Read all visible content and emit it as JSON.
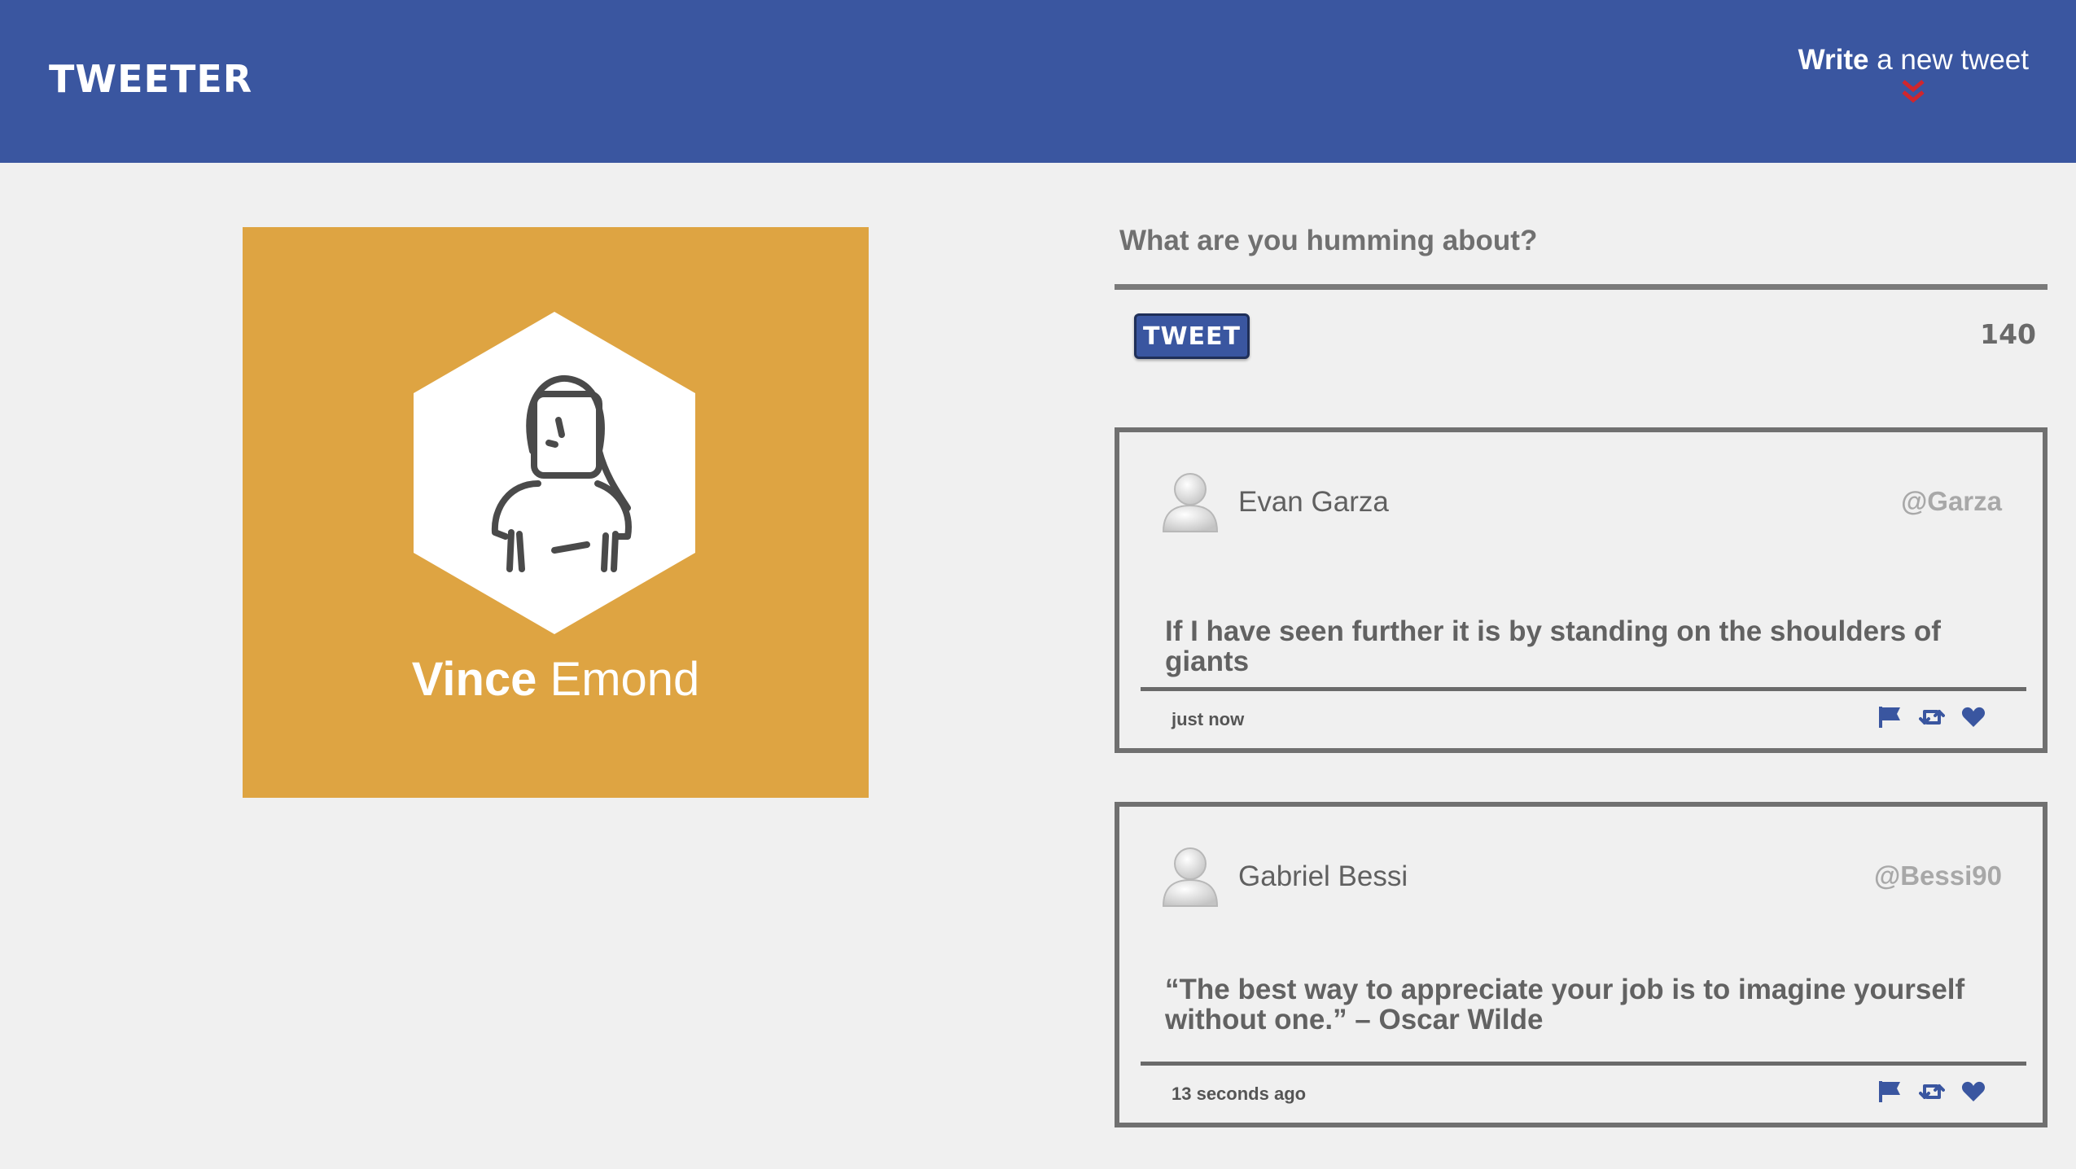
{
  "header": {
    "brand": "TWEETER",
    "compose_bold": "Write",
    "compose_rest": " a new tweet"
  },
  "profile": {
    "first_name": "Vince",
    "last_name": " Emond"
  },
  "compose": {
    "placeholder": "What are you humming about?",
    "button_label": "TWEET",
    "counter": "140"
  },
  "tweets": [
    {
      "name": "Evan Garza",
      "handle": "@Garza",
      "body": "If I have seen further it is by standing on the shoulders of giants",
      "time": "just now"
    },
    {
      "name": "Gabriel Bessi",
      "handle": "@Bessi90",
      "body": "“The best way to appreciate your job is to imagine yourself without one.” – Oscar Wilde",
      "time": "13 seconds ago"
    }
  ],
  "colors": {
    "nav": "#3a56a0",
    "profile_card": "#dea442",
    "accent_red": "#d0262d",
    "action_blue": "#3a56a0"
  },
  "icons": [
    "chevron-double-down-icon",
    "flag-icon",
    "retweet-icon",
    "heart-icon",
    "user-avatar-icon"
  ]
}
